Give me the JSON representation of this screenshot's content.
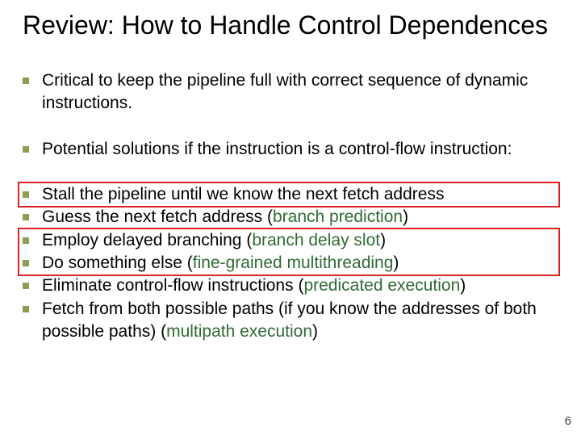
{
  "title": "Review: How to Handle Control Dependences",
  "intro": {
    "line1": "Critical to keep the pipeline full with correct sequence of dynamic instructions.",
    "line2": "Potential solutions if the instruction is a control-flow instruction:"
  },
  "solutions": {
    "s1": {
      "pre": "Stall the pipeline until we know the next fetch address",
      "term": ""
    },
    "s2": {
      "pre": "Guess the next fetch address (",
      "term": "branch prediction",
      "post": ")"
    },
    "s3": {
      "pre": "Employ delayed branching (",
      "term": "branch delay slot",
      "post": ")"
    },
    "s4": {
      "pre": "Do something else (",
      "term": "fine-grained multithreading",
      "post": ")"
    },
    "s5": {
      "pre": "Eliminate control-flow instructions (",
      "term": "predicated execution",
      "post": ")"
    },
    "s6": {
      "pre": "Fetch from both possible paths (if you know the addresses of both possible paths) (",
      "term": "multipath execution",
      "post": ")"
    }
  },
  "page": "6"
}
